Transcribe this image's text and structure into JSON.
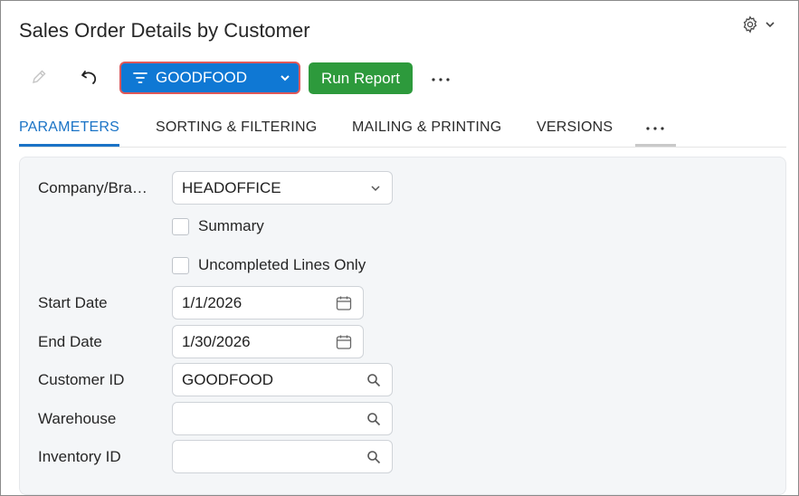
{
  "header": {
    "title": "Sales Order Details by Customer"
  },
  "toolbar": {
    "filter_label": "GOODFOOD",
    "run_label": "Run Report",
    "more_label": "···"
  },
  "tabs": [
    {
      "label": "PARAMETERS",
      "active": true
    },
    {
      "label": "SORTING & FILTERING",
      "active": false
    },
    {
      "label": "MAILING & PRINTING",
      "active": false
    },
    {
      "label": "VERSIONS",
      "active": false
    }
  ],
  "tabs_more_label": "···",
  "form": {
    "company": {
      "label": "Company/Bra…",
      "value": "HEADOFFICE"
    },
    "summary": {
      "label": "Summary",
      "checked": false
    },
    "uncompleted": {
      "label": "Uncompleted Lines Only",
      "checked": false
    },
    "start_date": {
      "label": "Start Date",
      "value": "1/1/2026"
    },
    "end_date": {
      "label": "End Date",
      "value": "1/30/2026"
    },
    "customer_id": {
      "label": "Customer ID",
      "value": "GOODFOOD"
    },
    "warehouse": {
      "label": "Warehouse",
      "value": ""
    },
    "inventory_id": {
      "label": "Inventory ID",
      "value": ""
    }
  },
  "icons": {
    "settings": "gear-icon",
    "edit": "pencil-icon",
    "undo": "undo-icon",
    "filter": "filter-icon",
    "calendar": "calendar-icon",
    "search": "search-icon"
  },
  "colors": {
    "primary": "#0f78d4",
    "run": "#2d9a3c",
    "tab_active": "#1a73c6",
    "focus_border": "#e05858"
  }
}
